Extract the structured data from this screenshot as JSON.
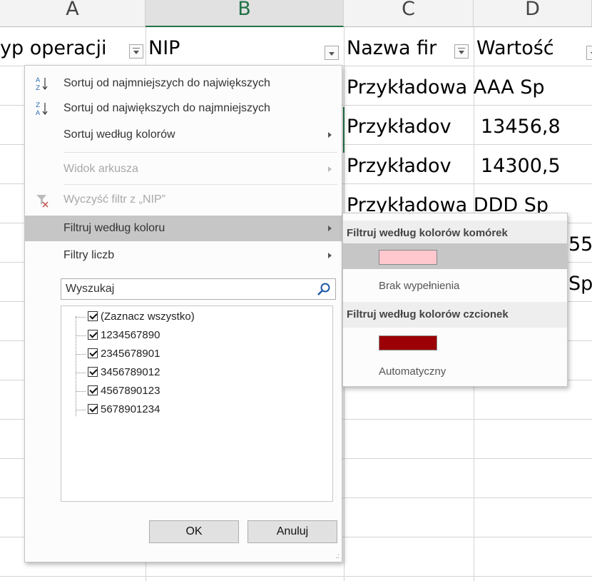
{
  "sheet": {
    "columns": [
      {
        "id": "col-a",
        "label": "A"
      },
      {
        "id": "col-b",
        "label": "B"
      },
      {
        "id": "col-c",
        "label": "C"
      },
      {
        "id": "col-d",
        "label": "D"
      }
    ],
    "headers": {
      "a": "yp operacji",
      "b": "NIP",
      "c": "Nazwa fir",
      "d": "Wartość"
    },
    "rows": [
      {
        "c": "Przykładowa AAA Sp",
        "d": ""
      },
      {
        "c": "Przykładov",
        "d": "13456,8"
      },
      {
        "c": "Przykładov",
        "d": "14300,5"
      },
      {
        "c": "Przykładowa DDD Sp",
        "d": ""
      },
      {
        "c": "",
        "d": "55"
      },
      {
        "c": "",
        "d": "Sp"
      }
    ]
  },
  "filter_menu": {
    "items": [
      {
        "label": "Sortuj od najmniejszych do największych",
        "icon": "sort-ascending-icon",
        "state": "normal"
      },
      {
        "label": "Sortuj od największych do najmniejszych",
        "icon": "sort-descending-icon",
        "state": "normal"
      },
      {
        "label": "Sortuj według kolorów",
        "state": "normal",
        "submenu": true
      },
      {
        "label": "Widok arkusza",
        "state": "disabled",
        "submenu": true
      },
      {
        "label": "Wyczyść filtr z „NIP”",
        "icon": "clear-filter-icon",
        "state": "disabled"
      },
      {
        "label": "Filtruj według koloru",
        "state": "active",
        "submenu": true
      },
      {
        "label": "Filtry liczb",
        "state": "normal",
        "submenu": true
      }
    ],
    "search": {
      "placeholder": "Wyszukaj",
      "value": ""
    },
    "values": [
      {
        "label": "(Zaznacz wszystko)",
        "checked": true
      },
      {
        "label": "1234567890",
        "checked": true
      },
      {
        "label": "2345678901",
        "checked": true
      },
      {
        "label": "3456789012",
        "checked": true
      },
      {
        "label": "4567890123",
        "checked": true
      },
      {
        "label": "5678901234",
        "checked": true
      }
    ],
    "ok_label": "OK",
    "cancel_label": "Anuluj"
  },
  "color_submenu": {
    "cell_colors_header": "Filtruj według kolorów komórek",
    "cell_color": "#ffc7ce",
    "no_fill_label": "Brak wypełnienia",
    "font_colors_header": "Filtruj według kolorów czcionek",
    "font_color": "#9c0006",
    "automatic_label": "Automatyczny"
  },
  "colors": {
    "accent": "#217346",
    "menu_active": "#c6c6c6"
  }
}
